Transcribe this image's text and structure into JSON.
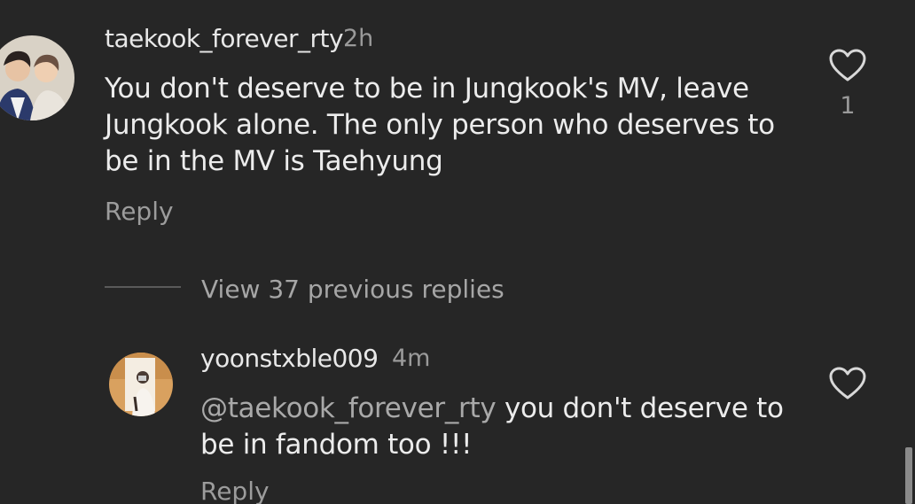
{
  "comment": {
    "username": "taekook_forever_rty",
    "time": "2h",
    "text": "You don't deserve to be in Jungkook's MV, leave Jungkook alone. The only person who deserves to be in the MV is Taehyung",
    "reply_label": "Reply",
    "like_count": "1"
  },
  "view_replies_label": "View 37 previous replies",
  "reply": {
    "username": "yoonstxble009",
    "time": "4m",
    "mention": "@taekook_forever_rty",
    "text": " you don't deserve to be in fandom too !!!",
    "reply_label": "Reply"
  },
  "colors": {
    "background": "#262626",
    "text": "#ececec",
    "secondary": "#9a9a9a"
  }
}
